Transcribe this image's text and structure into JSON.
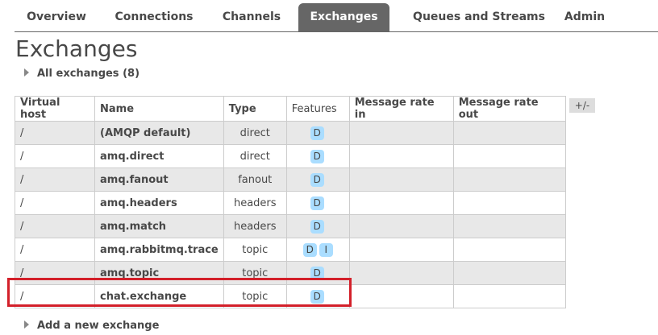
{
  "nav": {
    "tabs": [
      {
        "label": "Overview"
      },
      {
        "label": "Connections"
      },
      {
        "label": "Channels"
      },
      {
        "label": "Exchanges",
        "active": true
      },
      {
        "label": "Queues and Streams"
      },
      {
        "label": "Admin"
      }
    ]
  },
  "page": {
    "title": "Exchanges",
    "all_exchanges_label": "All exchanges (8)",
    "add_new_label": "Add a new exchange",
    "plus_minus": "+/-"
  },
  "table": {
    "headers": [
      "Virtual host",
      "Name",
      "Type",
      "Features",
      "Message rate in",
      "Message rate out"
    ],
    "rows": [
      {
        "vhost": "/",
        "name": "(AMQP default)",
        "type": "direct",
        "features": [
          "D"
        ],
        "rate_in": "",
        "rate_out": ""
      },
      {
        "vhost": "/",
        "name": "amq.direct",
        "type": "direct",
        "features": [
          "D"
        ],
        "rate_in": "",
        "rate_out": ""
      },
      {
        "vhost": "/",
        "name": "amq.fanout",
        "type": "fanout",
        "features": [
          "D"
        ],
        "rate_in": "",
        "rate_out": ""
      },
      {
        "vhost": "/",
        "name": "amq.headers",
        "type": "headers",
        "features": [
          "D"
        ],
        "rate_in": "",
        "rate_out": ""
      },
      {
        "vhost": "/",
        "name": "amq.match",
        "type": "headers",
        "features": [
          "D"
        ],
        "rate_in": "",
        "rate_out": ""
      },
      {
        "vhost": "/",
        "name": "amq.rabbitmq.trace",
        "type": "topic",
        "features": [
          "D",
          "I"
        ],
        "rate_in": "",
        "rate_out": ""
      },
      {
        "vhost": "/",
        "name": "amq.topic",
        "type": "topic",
        "features": [
          "D"
        ],
        "rate_in": "",
        "rate_out": ""
      },
      {
        "vhost": "/",
        "name": "chat.exchange",
        "type": "topic",
        "features": [
          "D"
        ],
        "rate_in": "",
        "rate_out": ""
      }
    ]
  },
  "colors": {
    "active_tab": "#666666",
    "badge": "#aaddff",
    "highlight": "#d3202a",
    "row_alt": "#e8e8e8"
  }
}
